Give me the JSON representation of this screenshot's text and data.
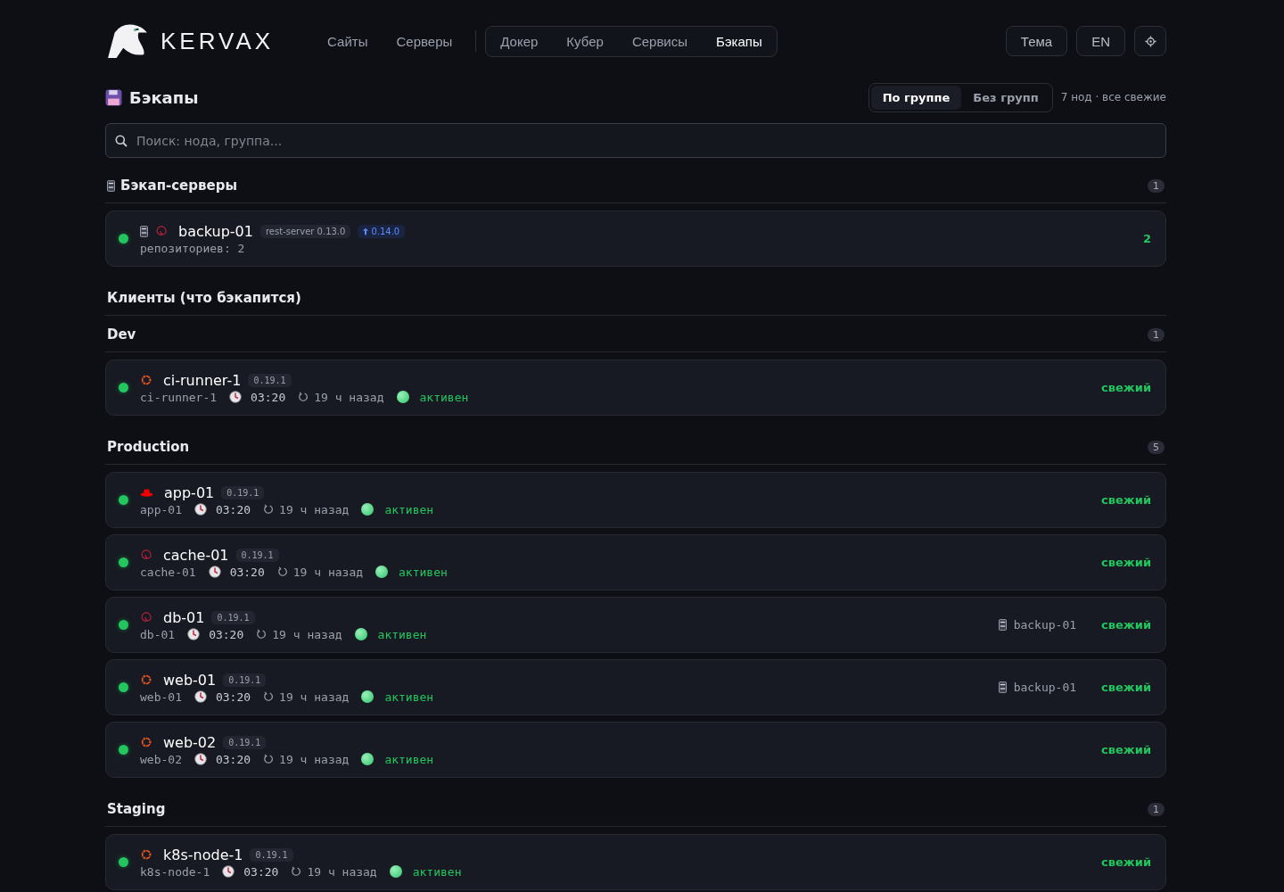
{
  "nav": {
    "brand": "KERVAX",
    "links": [
      {
        "label": "Сайты",
        "selected": false
      },
      {
        "label": "Серверы",
        "selected": false
      }
    ],
    "tabs": [
      {
        "label": "Докер",
        "selected": false
      },
      {
        "label": "Кубер",
        "selected": false
      },
      {
        "label": "Сервисы",
        "selected": false
      },
      {
        "label": "Бэкапы",
        "selected": true
      }
    ],
    "buttons": [
      "Тема",
      "EN"
    ]
  },
  "page": {
    "title": "Бэкапы",
    "views": [
      {
        "label": "По группе",
        "selected": true
      },
      {
        "label": "Без групп",
        "selected": false
      }
    ],
    "summary": "7 нод · все свежие"
  },
  "search": {
    "placeholder": "Поиск: нода, группа..."
  },
  "servers": {
    "title": "Бэкап-серверы",
    "count": "1",
    "items": [
      {
        "name": "backup-01",
        "kind": "debian",
        "online": true,
        "version": "rest-server 0.13.0",
        "update": "0.14.0",
        "repos": "репозиториев: 2",
        "count": "2"
      }
    ]
  },
  "clients": {
    "title": "Клиенты (что бэкапится)",
    "groups": [
      {
        "name": "Dev",
        "count": "1",
        "nodes": [
          {
            "name": "ci-runner-1",
            "kind": "ubuntu",
            "online": true,
            "version": "0.19.1",
            "host": "ci-runner-1",
            "time": "03:20",
            "ago": "19 ч назад",
            "status": "активен",
            "freshness": "свежий"
          }
        ]
      },
      {
        "name": "Production",
        "count": "5",
        "nodes": [
          {
            "name": "app-01",
            "kind": "redhat",
            "online": true,
            "version": "0.19.1",
            "host": "app-01",
            "time": "03:20",
            "ago": "19 ч назад",
            "status": "активен",
            "freshness": "свежий"
          },
          {
            "name": "cache-01",
            "kind": "debian",
            "online": true,
            "version": "0.19.1",
            "host": "cache-01",
            "time": "03:20",
            "ago": "19 ч назад",
            "status": "активен",
            "freshness": "свежий"
          },
          {
            "name": "db-01",
            "kind": "debian",
            "online": true,
            "version": "0.19.1",
            "host": "db-01",
            "time": "03:20",
            "ago": "19 ч назад",
            "status": "активен",
            "target": "backup-01",
            "freshness": "свежий"
          },
          {
            "name": "web-01",
            "kind": "ubuntu",
            "online": true,
            "version": "0.19.1",
            "host": "web-01",
            "time": "03:20",
            "ago": "19 ч назад",
            "status": "активен",
            "target": "backup-01",
            "freshness": "свежий"
          },
          {
            "name": "web-02",
            "kind": "ubuntu",
            "online": true,
            "version": "0.19.1",
            "host": "web-02",
            "time": "03:20",
            "ago": "19 ч назад",
            "status": "активен",
            "freshness": "свежий"
          }
        ]
      },
      {
        "name": "Staging",
        "count": "1",
        "nodes": [
          {
            "name": "k8s-node-1",
            "kind": "ubuntu",
            "online": true,
            "version": "0.19.1",
            "host": "k8s-node-1",
            "time": "03:20",
            "ago": "19 ч назад",
            "status": "активен",
            "freshness": "свежий"
          }
        ]
      }
    ]
  }
}
